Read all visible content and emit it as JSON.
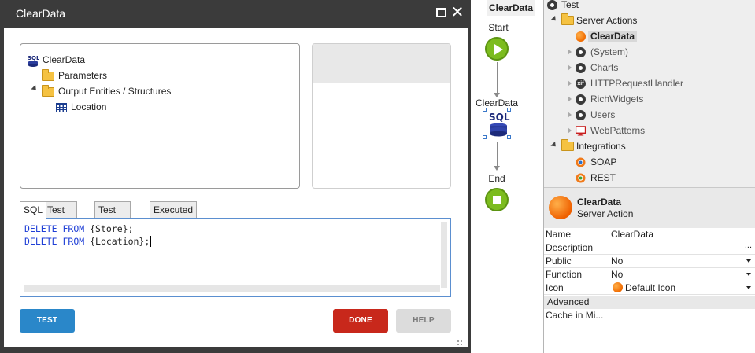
{
  "dialog": {
    "title": "ClearData",
    "tree": {
      "root": "ClearData",
      "parameters": "Parameters",
      "output": "Output Entities / Structures",
      "location": "Location"
    },
    "tabs": [
      "SQL",
      "Test Inputs",
      "Test Output",
      "Executed SQL"
    ],
    "sql": {
      "line1": {
        "kw1": "DELETE",
        "kw2": "FROM",
        "rest": " {Store};"
      },
      "line2": {
        "kw1": "DELETE",
        "kw2": "FROM",
        "rest": " {Location};"
      }
    },
    "buttons": {
      "test": "TEST",
      "done": "DONE",
      "help": "HELP"
    },
    "colors": {
      "test": "#2a87c9",
      "done": "#c8281b",
      "help": "#dcdcdc"
    }
  },
  "flow": {
    "header": "ClearData",
    "start_label": "Start",
    "node_label": "ClearData",
    "node_icon_text": "SQL",
    "end_label": "End",
    "accent": "#7cbc1e"
  },
  "tree": {
    "root": "Test",
    "server_actions": "Server Actions",
    "selected": "ClearData",
    "items": [
      "(System)",
      "Charts",
      "HTTPRequestHandler",
      "RichWidgets",
      "Users",
      "WebPatterns"
    ],
    "integrations": "Integrations",
    "integration_items": [
      "SOAP",
      "REST"
    ]
  },
  "properties": {
    "title": "ClearData",
    "subtitle": "Server Action",
    "rows": [
      {
        "key": "Name",
        "value": "ClearData"
      },
      {
        "key": "Description",
        "value": "",
        "extra": "..."
      },
      {
        "key": "Public",
        "value": "No"
      },
      {
        "key": "Function",
        "value": "No"
      },
      {
        "key": "Icon",
        "value": "Default Icon"
      }
    ],
    "section": "Advanced",
    "cache_key": "Cache in Mi..."
  }
}
